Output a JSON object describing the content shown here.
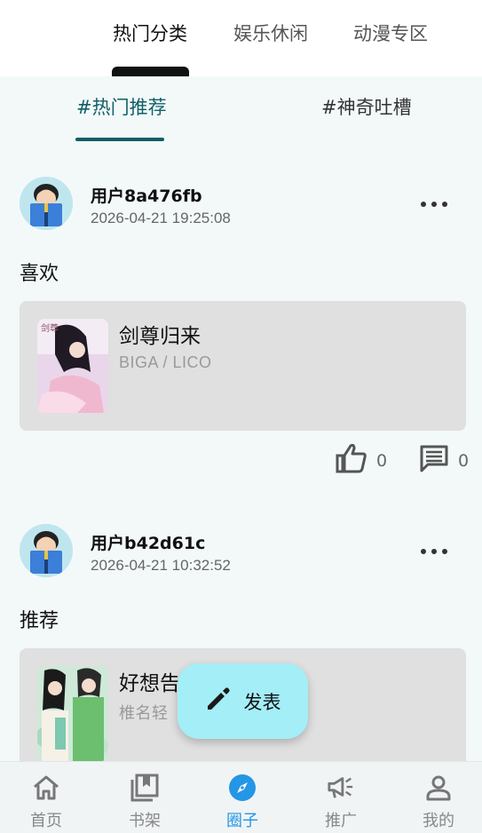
{
  "top_tabs": [
    "热门分类",
    "娱乐休闲",
    "动漫专区"
  ],
  "sub_tabs": [
    "#热门推荐",
    "#神奇吐槽"
  ],
  "posts": [
    {
      "username": "用户8a476fb",
      "time": "2026-04-21 19:25:08",
      "content": "喜欢",
      "book": {
        "title": "剑尊归来",
        "author": "BIGA / LICO"
      },
      "likes": "0",
      "comments": "0"
    },
    {
      "username": "用户b42d61c",
      "time": "2026-04-21 10:32:52",
      "content": "推荐",
      "book": {
        "title": "好想告",
        "author": "椎名轻"
      }
    }
  ],
  "fab": {
    "label": "发表",
    "icon": "pencil-icon"
  },
  "bottom_nav": [
    {
      "label": "首页",
      "icon": "home-icon"
    },
    {
      "label": "书架",
      "icon": "bookshelf-icon"
    },
    {
      "label": "圈子",
      "icon": "compass-icon"
    },
    {
      "label": "推广",
      "icon": "megaphone-icon"
    },
    {
      "label": "我的",
      "icon": "person-icon"
    }
  ],
  "colors": {
    "accent": "#0f5f66",
    "nav_active": "#2496e6",
    "fab_bg": "#a4eef8"
  }
}
